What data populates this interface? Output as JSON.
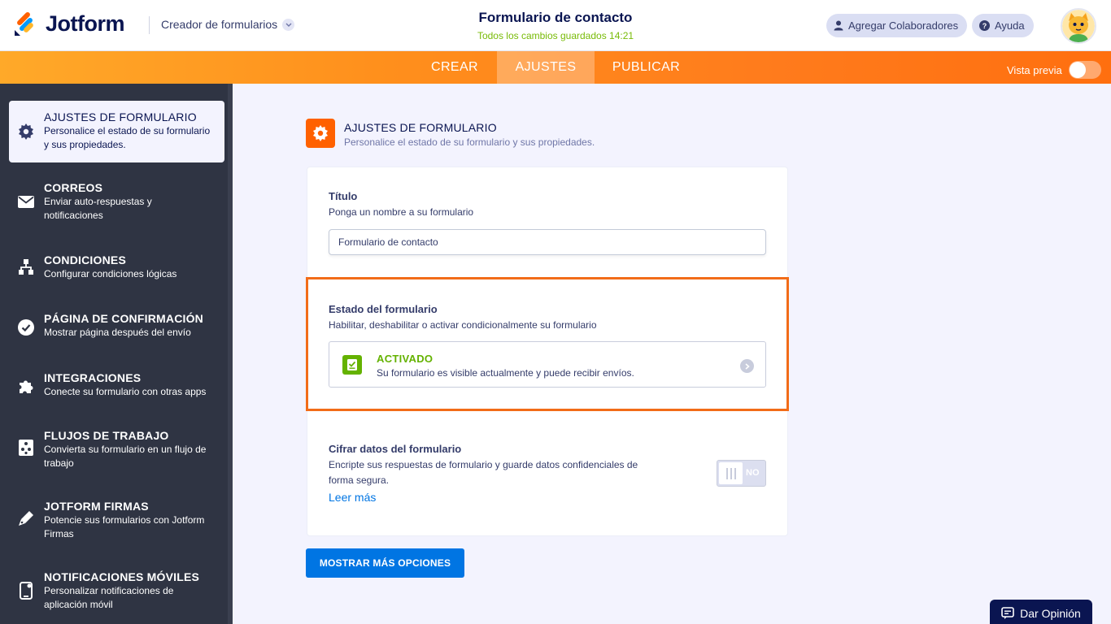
{
  "header": {
    "logo_text": "Jotform",
    "builder_dropdown": "Creador de formularios",
    "form_title": "Formulario de contacto",
    "save_status": "Todos los cambios guardados 14:21",
    "collaborators_label": "Agregar Colaboradores",
    "help_label": "Ayuda"
  },
  "nav": {
    "tabs": [
      {
        "label": "CREAR"
      },
      {
        "label": "AJUSTES"
      },
      {
        "label": "PUBLICAR"
      }
    ],
    "active_tab": "AJUSTES",
    "preview_label": "Vista previa",
    "preview_enabled": false
  },
  "sidebar": {
    "items": [
      {
        "title": "AJUSTES DE FORMULARIO",
        "desc_1": "Personalice el estado de su formulario",
        "desc_2": "y sus propiedades.",
        "icon": "gear-icon",
        "active": true
      },
      {
        "title": "CORREOS",
        "desc_1": "Enviar auto-respuestas y",
        "desc_2": "notificaciones",
        "icon": "envelope-icon"
      },
      {
        "title": "CONDICIONES",
        "desc_1": "Configurar condiciones lógicas",
        "icon": "sitemap-icon"
      },
      {
        "title": "PÁGINA DE CONFIRMACIÓN",
        "desc_1": "Mostrar página después del envío",
        "icon": "check-circle-icon"
      },
      {
        "title": "INTEGRACIONES",
        "desc_1": "Conecte su formulario con otras apps",
        "icon": "puzzle-icon"
      },
      {
        "title": "FLUJOS DE TRABAJO",
        "desc_1": "Convierta su formulario en un flujo de",
        "desc_2": "trabajo",
        "icon": "workflow-icon"
      },
      {
        "title": "JOTFORM FIRMAS",
        "desc_1": "Potencie sus formularios con Jotform",
        "desc_2": "Firmas",
        "icon": "pen-nib-icon"
      },
      {
        "title": "NOTIFICACIONES MÓVILES",
        "desc_1": "Personalizar notificaciones de",
        "desc_2": "aplicación móvil",
        "icon": "mobile-icon"
      }
    ]
  },
  "main": {
    "section_title": "AJUSTES DE FORMULARIO",
    "section_desc": "Personalice el estado de su formulario y sus propiedades.",
    "title_field": {
      "label": "Título",
      "desc": "Ponga un nombre a su formulario",
      "value": "Formulario de contacto"
    },
    "status_field": {
      "label": "Estado del formulario",
      "desc": "Habilitar, deshabilitar o activar condicionalmente su formulario",
      "status": "ACTIVADO",
      "status_desc": "Su formulario es visible actualmente y puede recibir envíos."
    },
    "encrypt_field": {
      "label": "Cifrar datos del formulario",
      "desc_1": "Encripte sus respuestas de formulario y guarde datos confidenciales de",
      "desc_2": "forma segura.",
      "read_more": "Leer más",
      "toggle_label": "NO",
      "enabled": false
    },
    "more_options_button": "MOSTRAR MÁS OPCIONES"
  },
  "feedback_button": "Dar Opinión",
  "colors": {
    "brand_orange": "#ff6100",
    "nav_gradient_start": "#ffa929",
    "nav_gradient_end": "#ff6f0f",
    "sidebar_bg": "#2f3443",
    "primary_blue": "#0075e3",
    "active_green": "#64b200",
    "navy": "#0a1551"
  }
}
